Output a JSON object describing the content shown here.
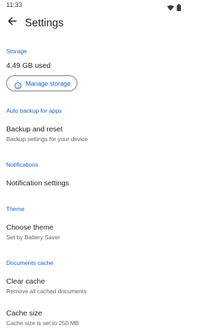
{
  "status_bar": {
    "time": "11:33",
    "icons": [
      "wifi-icon",
      "battery-icon"
    ]
  },
  "app_bar": {
    "title": "Settings"
  },
  "storage": {
    "header": "Storage",
    "used": "4.49 GB used",
    "manage_button": "Manage storage"
  },
  "auto_backup": {
    "header": "Auto backup for apps",
    "item_title": "Backup and reset",
    "item_subtitle": "Backup settings for your device"
  },
  "notifications": {
    "header": "Notifications",
    "item_title": "Notification settings"
  },
  "theme": {
    "header": "Theme",
    "item_title": "Choose theme",
    "item_subtitle": "Set by Battery Saver"
  },
  "documents_cache": {
    "header": "Documents cache",
    "clear_title": "Clear cache",
    "clear_subtitle": "Remove all cached documents",
    "size_title": "Cache size",
    "size_subtitle": "Cache size is set to 250 MB"
  },
  "colors": {
    "accent": "#1a5fd0",
    "text_primary": "#1f1f1f",
    "text_secondary": "#5f6368",
    "background": "#ffffff"
  }
}
